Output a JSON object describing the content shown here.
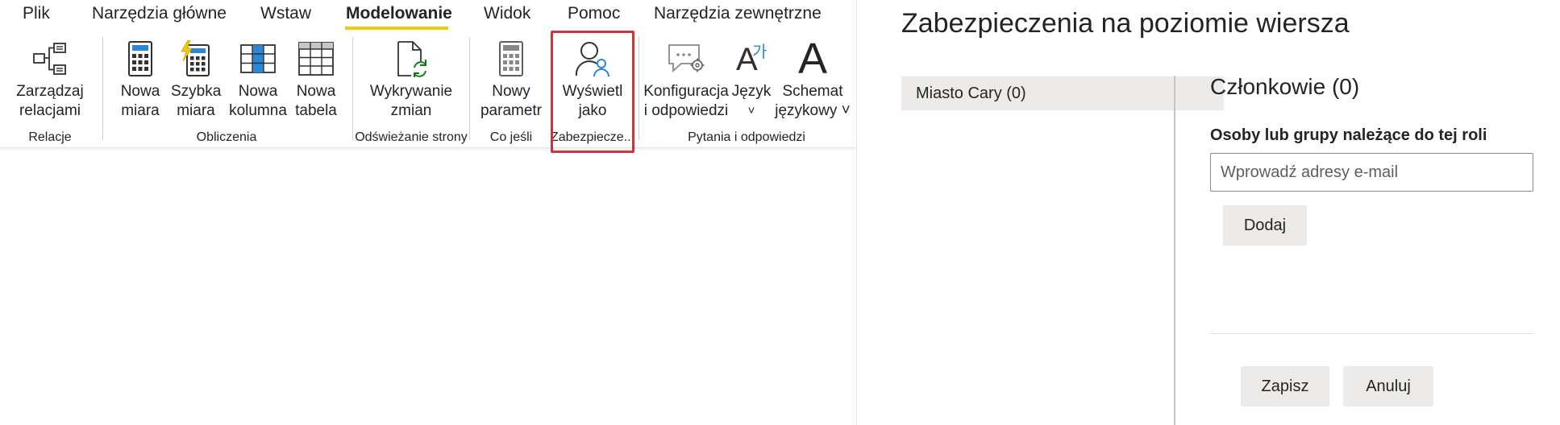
{
  "tabs": [
    {
      "label": "Plik"
    },
    {
      "label": "Narzędzia główne"
    },
    {
      "label": "Wstaw"
    },
    {
      "label": "Modelowanie",
      "active": true
    },
    {
      "label": "Widok"
    },
    {
      "label": "Pomoc"
    },
    {
      "label": "Narzędzia zewnętrzne"
    }
  ],
  "ribbon": {
    "buttons": [
      {
        "line1": "Zarządzaj",
        "line2": "relacjami",
        "icon": "manage-relationships-icon"
      },
      {
        "line1": "Nowa",
        "line2": "miara",
        "icon": "calculator-icon"
      },
      {
        "line1": "Szybka",
        "line2": "miara",
        "icon": "quick-measure-icon"
      },
      {
        "line1": "Nowa",
        "line2": "kolumna",
        "icon": "new-column-icon"
      },
      {
        "line1": "Nowa",
        "line2": "tabela",
        "icon": "new-table-icon"
      },
      {
        "line1": "Wykrywanie",
        "line2": "zmian",
        "icon": "change-detection-icon"
      },
      {
        "line1": "Nowy",
        "line2": "parametr",
        "icon": "parameter-calculator-icon"
      },
      {
        "line1": "Wyświetl",
        "line2": "jako",
        "icon": "view-as-user-icon"
      },
      {
        "line1": "Konfiguracja",
        "line2": "i odpowiedzi",
        "icon": "qa-setup-icon"
      },
      {
        "line1": "Język",
        "line2": "˅",
        "icon": "language-icon"
      },
      {
        "line1": "Schemat",
        "line2": "językowy ˅",
        "icon": "linguistic-schema-icon"
      }
    ],
    "groups": [
      {
        "label": "Relacje"
      },
      {
        "label": "Obliczenia"
      },
      {
        "label": "Odświeżanie strony"
      },
      {
        "label": "Co jeśli"
      },
      {
        "label": "Zabezpiecze..."
      },
      {
        "label": "Pytania i odpowiedzi"
      }
    ],
    "language_glyph": "가",
    "schema_glyph": "A"
  },
  "panel": {
    "title": "Zabezpieczenia na poziomie wiersza",
    "roles": [
      {
        "label": "Miasto Cary (0)"
      }
    ],
    "members_title": "Członkowie (0)",
    "members_subtitle": "Osoby lub grupy należące do tej roli",
    "email_placeholder": "Wprowadź adresy e-mail",
    "add_label": "Dodaj",
    "save_label": "Zapisz",
    "cancel_label": "Anuluj"
  },
  "colors": {
    "accent_underline": "#f2c811",
    "highlight_border": "#d13438",
    "icon_blue": "#2b88d8",
    "icon_dark": "#323130",
    "icon_green": "#107c10",
    "button_gray": "#edebe9"
  }
}
